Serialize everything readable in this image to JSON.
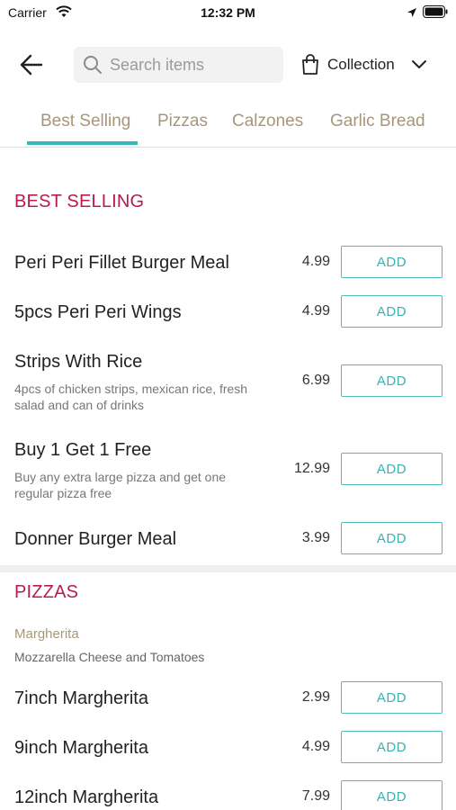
{
  "status": {
    "carrier": "Carrier",
    "time": "12:32 PM"
  },
  "header": {
    "search_placeholder": "Search items",
    "collection_label": "Collection"
  },
  "tabs": [
    "Best Selling",
    "Pizzas",
    "Calzones",
    "Garlic Bread"
  ],
  "sections": {
    "best_selling": {
      "title": "BEST SELLING",
      "items": [
        {
          "name": "Peri Peri Fillet Burger Meal",
          "price": "4.99",
          "add": "ADD"
        },
        {
          "name": "5pcs Peri Peri Wings",
          "price": "4.99",
          "add": "ADD"
        },
        {
          "name": "Strips With Rice",
          "desc": "4pcs of chicken strips, mexican rice, fresh salad and can of drinks",
          "price": "6.99",
          "add": "ADD"
        },
        {
          "name": "Buy 1 Get 1 Free",
          "desc": "Buy any extra large pizza and get one regular pizza free",
          "price": "12.99",
          "add": "ADD"
        },
        {
          "name": "Donner Burger Meal",
          "price": "3.99",
          "add": "ADD"
        }
      ]
    },
    "pizzas": {
      "title": "PIZZAS",
      "subcategory": "Margherita",
      "subcategory_desc": "Mozzarella Cheese and Tomatoes",
      "items": [
        {
          "name": "7inch Margherita",
          "price": "2.99",
          "add": "ADD"
        },
        {
          "name": "9inch Margherita",
          "price": "4.99",
          "add": "ADD"
        },
        {
          "name": "12inch Margherita",
          "price": "7.99",
          "add": "ADD"
        }
      ]
    }
  }
}
